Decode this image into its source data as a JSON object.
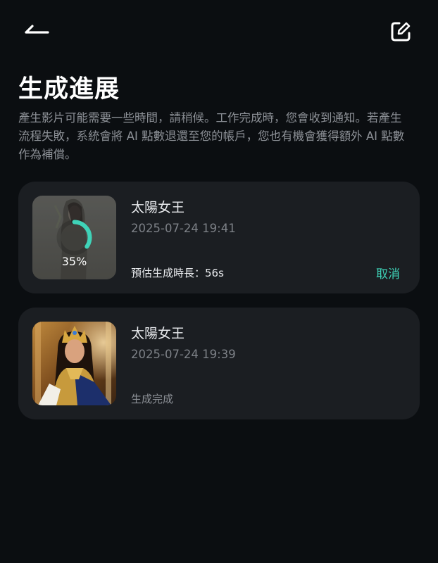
{
  "header": {
    "back_icon": "back-arrow-icon",
    "edit_icon": "edit-icon"
  },
  "page": {
    "title": "生成進展",
    "description": "產生影片可能需要一些時間，請稍候。工作完成時，您會收到通知。若產生流程失敗，系統會將 AI 點數退還至您的帳戶，您也有機會獲得額外 AI 點數作為補償。"
  },
  "colors": {
    "background": "#0b0e11",
    "card": "#1b1e22",
    "accent": "#3fd3b8"
  },
  "tasks": [
    {
      "title": "太陽女王",
      "date": "2025-07-24 19:41",
      "progress": 0.35,
      "progress_text": "35%",
      "status": "預估生成時長：56s",
      "cancel_label": "取消"
    },
    {
      "title": "太陽女王",
      "date": "2025-07-24 19:39",
      "status": "生成完成"
    }
  ]
}
